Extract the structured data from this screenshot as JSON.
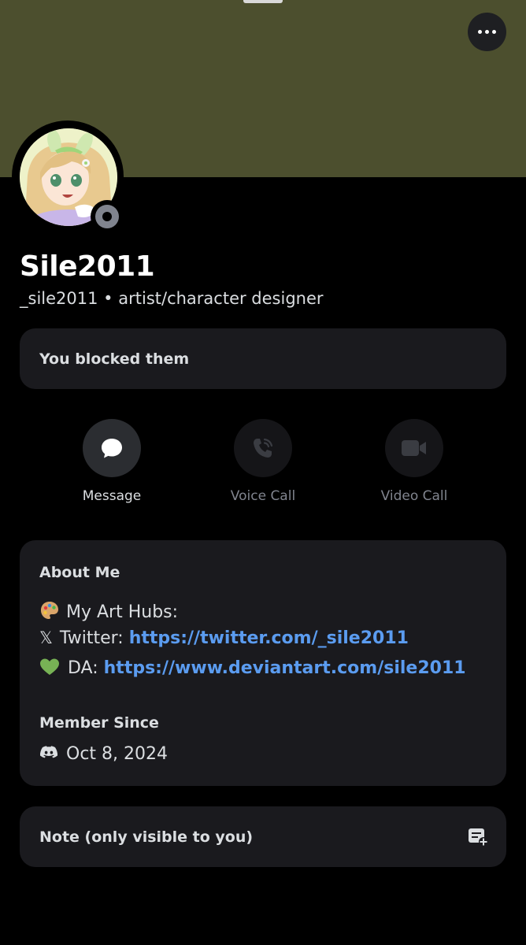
{
  "profile": {
    "display_name": "Sile2011",
    "username": "_sile2011",
    "separator": "•",
    "pronouns_bio": "artist/character designer",
    "status": "offline",
    "banner_color": "#4c4f2e"
  },
  "blocked": {
    "label": "You blocked them"
  },
  "actions": [
    {
      "label": "Message",
      "icon": "chat-bubble-icon",
      "enabled": true
    },
    {
      "label": "Voice Call",
      "icon": "phone-call-icon",
      "enabled": false
    },
    {
      "label": "Video Call",
      "icon": "video-camera-icon",
      "enabled": false
    }
  ],
  "about": {
    "title": "About Me",
    "line1": "My Art Hubs:",
    "twitter_prefix": "Twitter:",
    "twitter_url": "https://twitter.com/_sile2011",
    "da_prefix": "DA:",
    "da_url": "https://www.deviantart.com/sile2011",
    "member_since_title": "Member Since",
    "member_since_date": "Oct 8, 2024"
  },
  "note": {
    "label": "Note (only visible to you)"
  },
  "colors": {
    "link": "#5b9cf0",
    "card_bg": "#1a1a1e",
    "muted": "#80848e"
  }
}
